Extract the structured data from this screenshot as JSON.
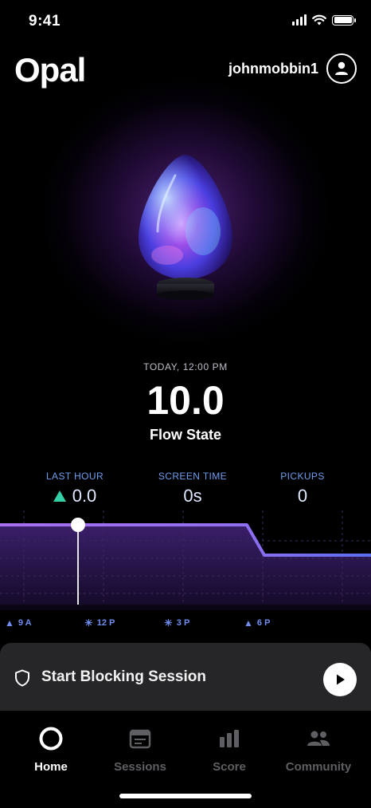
{
  "status_bar": {
    "time": "9:41"
  },
  "header": {
    "logo": "Opal",
    "username": "johnmobbin1"
  },
  "score": {
    "date_label": "TODAY, 12:00 PM",
    "value": "10.0",
    "label": "Flow State"
  },
  "stats": [
    {
      "label": "LAST HOUR",
      "value": "0.0",
      "icon": "up-triangle-icon"
    },
    {
      "label": "SCREEN TIME",
      "value": "0s"
    },
    {
      "label": "PICKUPS",
      "value": "0"
    }
  ],
  "chart_data": {
    "type": "line",
    "x": [
      "9 A",
      "12 P",
      "3 P",
      "6 P"
    ],
    "series": [
      {
        "values": [
          0.65,
          0.65,
          0.45
        ]
      }
    ],
    "time_labels": [
      {
        "label": "9 A",
        "icon": "sunrise-icon"
      },
      {
        "label": "12 P",
        "icon": "sun-icon"
      },
      {
        "label": "3 P",
        "icon": "sun-icon"
      },
      {
        "label": "6 P",
        "icon": "sunset-icon"
      }
    ],
    "line_color": "#8f6ff0",
    "accent": "#6f8ef0"
  },
  "session": {
    "label": "Start Blocking Session"
  },
  "tabs": [
    {
      "label": "Home",
      "active": true
    },
    {
      "label": "Sessions",
      "active": false
    },
    {
      "label": "Score",
      "active": false
    },
    {
      "label": "Community",
      "active": false
    }
  ],
  "colors": {
    "background": "#000000",
    "accent_blue": "#6f9ef0",
    "accent_green": "#35d1a6",
    "session_bar": "#262629"
  }
}
